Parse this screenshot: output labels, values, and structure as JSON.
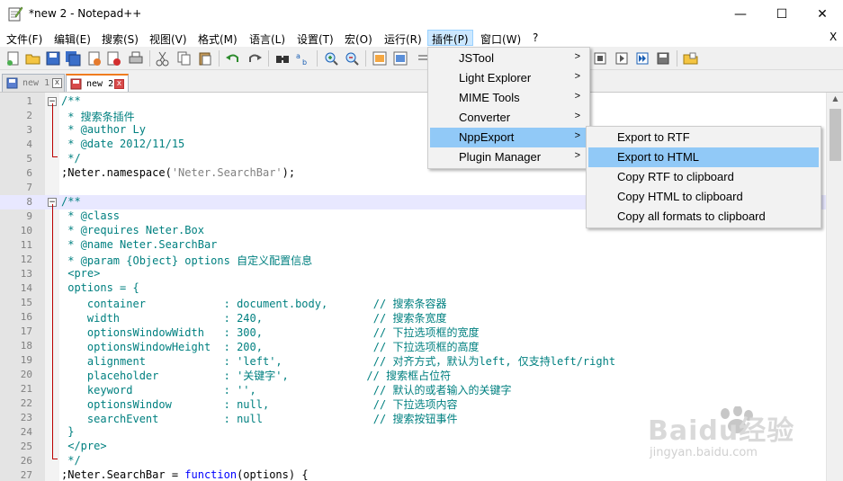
{
  "window": {
    "title": "*new 2 - Notepad++",
    "minimize": "—",
    "maximize": "☐",
    "close": "✕"
  },
  "menubar": {
    "items": [
      "文件(F)",
      "编辑(E)",
      "搜索(S)",
      "视图(V)",
      "格式(M)",
      "语言(L)",
      "设置(T)",
      "宏(O)",
      "运行(R)",
      "插件(P)",
      "窗口(W)",
      "?"
    ],
    "active_index": 9,
    "close_label": "X"
  },
  "tabs": [
    {
      "label": "new 1",
      "active": false
    },
    {
      "label": "new 2",
      "active": true
    }
  ],
  "editor": {
    "current_line": 8,
    "lines": [
      {
        "n": "1",
        "fold": "box",
        "parts": [
          {
            "c": "cmt",
            "t": "/**"
          }
        ]
      },
      {
        "n": "2",
        "parts": [
          {
            "c": "cmt",
            "t": " * 搜索条插件"
          }
        ]
      },
      {
        "n": "3",
        "parts": [
          {
            "c": "cmt",
            "t": " * @author Ly"
          }
        ]
      },
      {
        "n": "4",
        "parts": [
          {
            "c": "cmt",
            "t": " * @date 2012/11/15"
          }
        ]
      },
      {
        "n": "5",
        "fold": "end",
        "parts": [
          {
            "c": "cmt",
            "t": " */"
          }
        ]
      },
      {
        "n": "6",
        "parts": [
          {
            "c": "plain",
            "t": ";Neter.namespace("
          },
          {
            "c": "str",
            "t": "'Neter.SearchBar'"
          },
          {
            "c": "plain",
            "t": ");"
          }
        ]
      },
      {
        "n": "7",
        "parts": []
      },
      {
        "n": "8",
        "fold": "box",
        "parts": [
          {
            "c": "cmt",
            "t": "/**"
          }
        ]
      },
      {
        "n": "9",
        "parts": [
          {
            "c": "cmt",
            "t": " * @class"
          }
        ]
      },
      {
        "n": "10",
        "parts": [
          {
            "c": "cmt",
            "t": " * @requires Neter.Box"
          }
        ]
      },
      {
        "n": "11",
        "parts": [
          {
            "c": "cmt",
            "t": " * @name Neter.SearchBar"
          }
        ]
      },
      {
        "n": "12",
        "parts": [
          {
            "c": "cmt",
            "t": " * @param {Object} options 自定义配置信息"
          }
        ]
      },
      {
        "n": "13",
        "parts": [
          {
            "c": "cmt",
            "t": " <pre>"
          }
        ]
      },
      {
        "n": "14",
        "parts": [
          {
            "c": "cmt",
            "t": " options = {"
          }
        ]
      },
      {
        "n": "15",
        "parts": [
          {
            "c": "cmt",
            "t": "    container            : document.body,       // 搜索条容器"
          }
        ]
      },
      {
        "n": "16",
        "parts": [
          {
            "c": "cmt",
            "t": "    width                : 240,                 // 搜索条宽度"
          }
        ]
      },
      {
        "n": "17",
        "parts": [
          {
            "c": "cmt",
            "t": "    optionsWindowWidth   : 300,                 // 下拉选项框的宽度"
          }
        ]
      },
      {
        "n": "18",
        "parts": [
          {
            "c": "cmt",
            "t": "    optionsWindowHeight  : 200,                 // 下拉选项框的高度"
          }
        ]
      },
      {
        "n": "19",
        "parts": [
          {
            "c": "cmt",
            "t": "    alignment            : 'left',              // 对齐方式，默认为left, 仅支持left/right"
          }
        ]
      },
      {
        "n": "20",
        "parts": [
          {
            "c": "cmt",
            "t": "    placeholder          : '关键字',            // 搜索框占位符"
          }
        ]
      },
      {
        "n": "21",
        "parts": [
          {
            "c": "cmt",
            "t": "    keyword              : '',                  // 默认的或者输入的关键字"
          }
        ]
      },
      {
        "n": "22",
        "parts": [
          {
            "c": "cmt",
            "t": "    optionsWindow        : null,                // 下拉选项内容"
          }
        ]
      },
      {
        "n": "23",
        "parts": [
          {
            "c": "cmt",
            "t": "    searchEvent          : null                 // 搜索按钮事件"
          }
        ]
      },
      {
        "n": "24",
        "parts": [
          {
            "c": "cmt",
            "t": " }"
          }
        ]
      },
      {
        "n": "25",
        "parts": [
          {
            "c": "cmt",
            "t": " </pre>"
          }
        ]
      },
      {
        "n": "26",
        "fold": "end",
        "parts": [
          {
            "c": "cmt",
            "t": " */"
          }
        ]
      },
      {
        "n": "27",
        "parts": [
          {
            "c": "plain",
            "t": ";Neter.SearchBar = "
          },
          {
            "c": "kw",
            "t": "function"
          },
          {
            "c": "plain",
            "t": "(options) {"
          }
        ]
      }
    ]
  },
  "plugins_menu": {
    "items": [
      {
        "label": "JSTool",
        "submenu": true
      },
      {
        "label": "Light Explorer",
        "submenu": true
      },
      {
        "label": "MIME Tools",
        "submenu": true
      },
      {
        "label": "Converter",
        "submenu": true
      },
      {
        "label": "NppExport",
        "submenu": true,
        "highlighted": true
      },
      {
        "label": "Plugin Manager",
        "submenu": true
      }
    ]
  },
  "nppexport_menu": {
    "items": [
      {
        "label": "Export to RTF"
      },
      {
        "label": "Export to HTML",
        "highlighted": true
      },
      {
        "label": "Copy RTF to clipboard"
      },
      {
        "label": "Copy HTML to clipboard"
      },
      {
        "label": "Copy all formats to clipboard"
      }
    ]
  },
  "watermark": {
    "brand": "Baidu经验",
    "url": "jingyan.baidu.com"
  },
  "colors": {
    "comment": "#008080",
    "keyword": "#0000ff",
    "string": "#808080",
    "menu_highlight": "#91c9f7",
    "current_line": "#e8e8ff"
  }
}
